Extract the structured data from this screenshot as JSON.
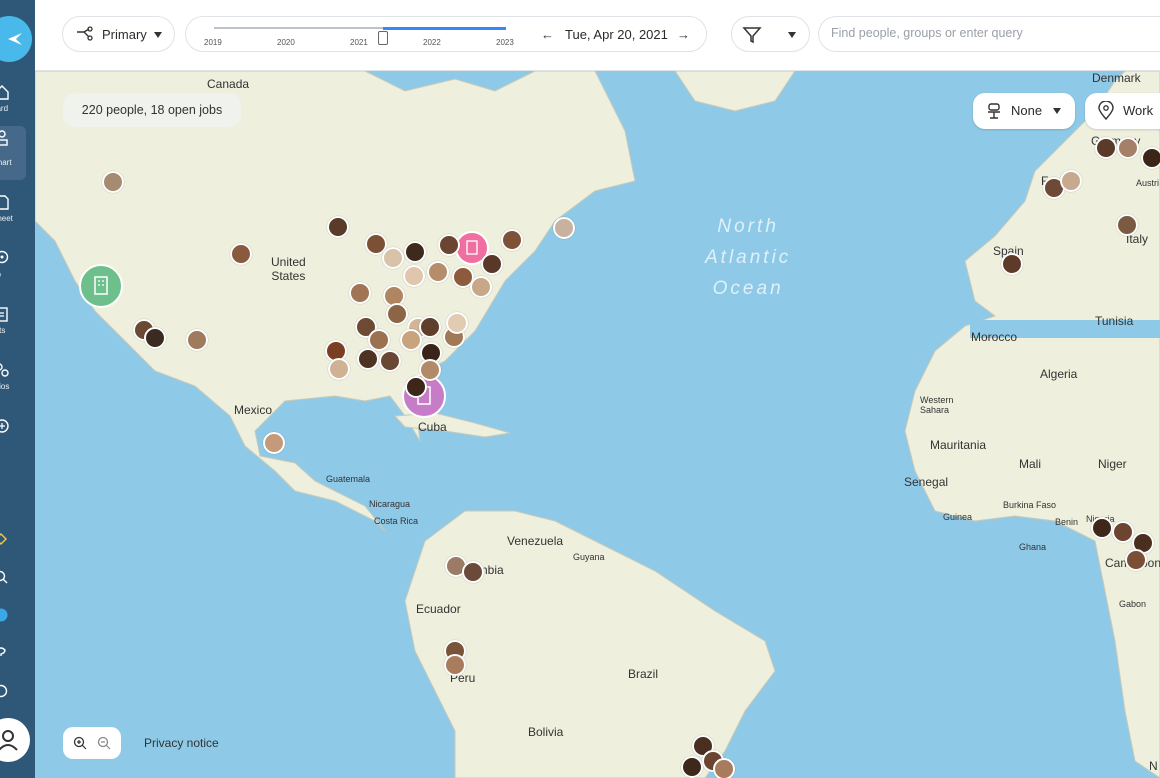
{
  "sidebar": {
    "items": [
      {
        "label": "oard",
        "icon": "home-icon"
      },
      {
        "label": "Chart",
        "icon": "org-chart-icon"
      },
      {
        "label": "Sheet",
        "icon": "sheet-icon"
      },
      {
        "label": "ap",
        "icon": "map-pin-icon"
      },
      {
        "label": "orts",
        "icon": "reports-icon"
      },
      {
        "label": "arios",
        "icon": "scenarios-icon"
      },
      {
        "label": "re",
        "icon": "more-icon"
      }
    ]
  },
  "toolbar": {
    "view_label": "Primary",
    "years": [
      "2019",
      "2020",
      "2021",
      "2022",
      "2023"
    ],
    "timeline_position": 0.58,
    "date_label": "Tue, Apr 20, 2021",
    "search_placeholder": "Find people, groups or enter query"
  },
  "map": {
    "summary": "220 people, 18 open jobs",
    "group_by_label": "None",
    "location_type_label": "Work",
    "privacy_label": "Privacy notice",
    "ocean_label": "North\nAtlantic\nOcean",
    "labels": {
      "canada": "Canada",
      "denmark": "Denmark",
      "united_states": "United\nStates",
      "mexico": "Mexico",
      "cuba": "Cuba",
      "guatemala": "Guatemala",
      "nicaragua": "Nicaragua",
      "costa_rica": "Costa Rica",
      "venezuela": "Venezuela",
      "guyana": "Guyana",
      "colombia": "Colombia",
      "ecuador": "Ecuador",
      "peru": "Peru",
      "brazil": "Brazil",
      "bolivia": "Bolivia",
      "spain": "Spain",
      "italy": "Italy",
      "germany": "Germany",
      "france": "France",
      "austria": "Austri",
      "tunisia": "Tunisia",
      "morocco": "Morocco",
      "algeria": "Algeria",
      "western_sahara": "Western\nSahara",
      "mauritania": "Mauritania",
      "mali": "Mali",
      "niger": "Niger",
      "senegal": "Senegal",
      "guinea": "Guinea",
      "burkina_faso": "Burkina Faso",
      "benin": "Benin",
      "ghana": "Ghana",
      "nigeria": "Nigeria",
      "cameroon": "Cameroon",
      "gabon": "Gabon",
      "n": "N"
    }
  },
  "colors": {
    "sidebar": "#2F5878",
    "accent": "#3A86F7",
    "ocean": "#8ECAE8",
    "land": "#EEF0DD",
    "office_green": "#6DBF8B",
    "office_purple": "#C77CC7",
    "office_pink": "#EE6FA0"
  }
}
